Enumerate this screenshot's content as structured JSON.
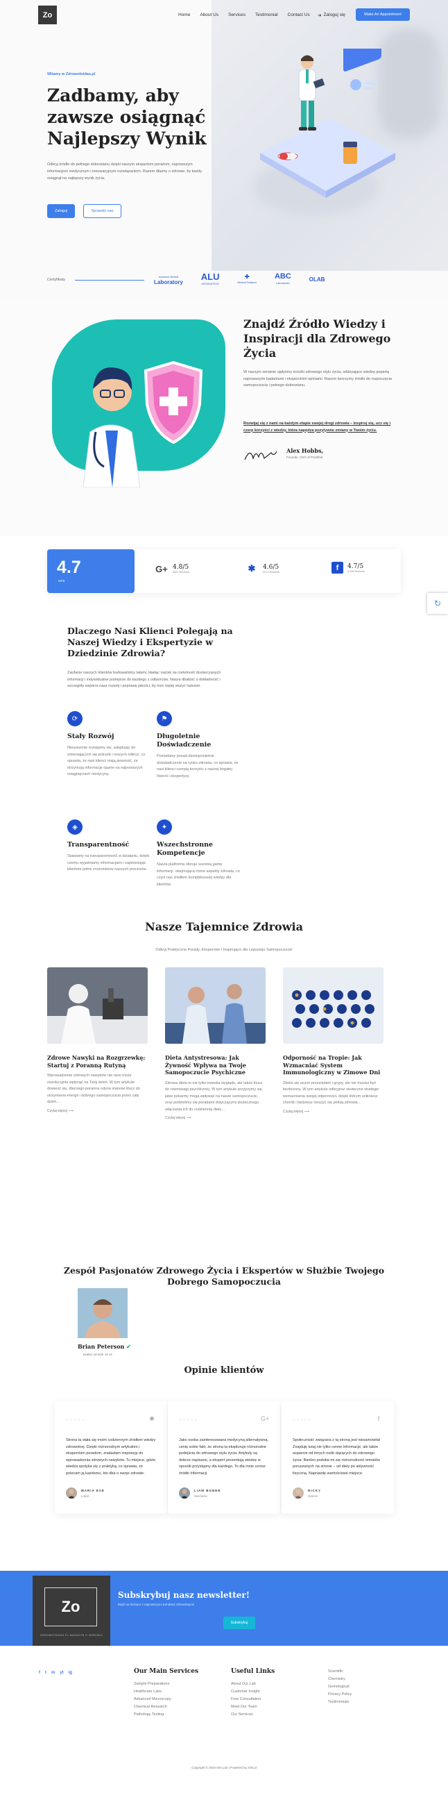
{
  "header": {
    "logo": "Zo",
    "nav": [
      "Home",
      "About Us",
      "Services",
      "Testimonial",
      "Contact Us"
    ],
    "login": "Zaloguj się",
    "cta": "Make An Appointment"
  },
  "hero": {
    "eyebrow": "Witamy w Zdrowotnidas.pl",
    "title": "Zadbamy, aby zawsze osiągnąć Najlepszy Wynik",
    "text": "Odkryj źródło do pełnego dobrostanu dzięki naszym ekspertom porażom, najnowszym informacjom medycznym i innowacyjnym rozwiązaniom. Razem dbamy o zdrowie, by każdy osiągnął na najlepszy wynik życia.",
    "btn_primary": "Zaloguj",
    "btn_outline": "Sprawdź nas"
  },
  "certified": {
    "label": "Certyfikaty",
    "logos": [
      {
        "name": "Laboratory",
        "small": "Advanced Medical"
      },
      {
        "name": "ALU",
        "small": "DESIGN&TECH"
      },
      {
        "name": "✚",
        "small": "Medical Solutions"
      },
      {
        "name": "ABC",
        "small": "Laboratories"
      },
      {
        "name": "OLAB",
        "small": ""
      }
    ]
  },
  "about": {
    "title": "Znajdź Źródło Wiedzy i Inspiracji dla Zdrowego Życia",
    "text": "W naszym serwisie ujęłyśmy ścieżki zdrowego stylu życia, oddzyające wiedzę popartą najnowszymi badaniami i eksperckimi opiniami. Razem tworzymy źródło do rozpoczęcia samopoczucia i pełnego dobrostanu.",
    "quote": "Rozwijaj się z nami na każdym etapie swojej drogi zdrowia – inspiruj się, ucz się i czerp korzyści z wiedzy, która napędza pozytywne zmiany w Twoim życiu.",
    "author": "Alex Hobbs,",
    "role": "Founder, CEO of Pointflub"
  },
  "ratings": {
    "main_value": "4.7",
    "main_label": "GPS",
    "items": [
      {
        "icon": "G+",
        "value": "4.8/5",
        "sub": "5467 Reviews"
      },
      {
        "icon": "✱",
        "value": "4.6/5",
        "sub": "3274 Reviews"
      },
      {
        "icon": "f",
        "value": "4.7/5",
        "sub": "3,435 Reviews"
      }
    ]
  },
  "why": {
    "title": "Dlaczego Nasi Klienci Polegają na Naszej Wiedzy i Ekspertyzie w Dziedzinie Zdrowia?",
    "text": "Zaufanie naszych klientów budowaliśmy latami, kładąc nacisk na rzetelność dostarczanych informacji i indywidualne podejście do każdego z odbiorców. Nasza dbałość o dokładność i szczegóły wspiera nasz rozwój i poprawę jakości, by móc lepiej służyć ludziom.",
    "features": [
      {
        "title": "Stały Rozwój",
        "text": "Nieustannie rozwijamy się, adaptując do zmieniających się potrzeb i nowych odkryć, co sprawia, że nasi klienci mają pewność, że otrzymują informacje oparte na najnowszych osiągnięciach medycyny."
      },
      {
        "title": "Długoletnie Doświadczenie",
        "text": "Posiadamy ponad dziesięcioletnie doświadczenie na rynku zdrowia, co sprawia, że nasi klienci czerpią korzyści z naszej bogatej historii i ekspertyzy."
      },
      {
        "title": "Transparentność",
        "text": "Stawiamy na transparentność w działaniu, dzięki czemu wyjaśniamy informacjami i zapewniając klientom pełne zrozumienie naszych procesów."
      },
      {
        "title": "Wszechstronne Kompetencje",
        "text": "Nasza platforma oferuje szeroką gamę informacji, obejmującą różne aspekty zdrowia, co czyni nas źródłem kompleksowej wiedzy dla klientów."
      }
    ]
  },
  "blog": {
    "title": "Nasze Tajemnice Zdrowia",
    "subtitle": "Odkryj Praktyczne Porady, Eksperckie i Inspirujące dla Lepszego Samopoczucia!",
    "posts": [
      {
        "title": "Zdrowe Nawyki na Rozgrzewkę: Startuj z Poranną Rutyną",
        "text": "Wprowadzenie zdrowych nawyków nie rano może rewolucyjnie wpłynąć na Twój dzień. W tym artykule dowiesz się, dlaczego poranna rutyna stanowi klucz do utrzymania energii i dobrego samopoczucia przez cały dzień…",
        "more": "Czytaj więcej"
      },
      {
        "title": "Dieta Antystresowa: Jak Żywność Wpływa na Twoje Samopoczucie Psychiczne",
        "text": "Zdrowa dieta to nie tylko kwestia wyglądu, ale także klucz do równowagi psychicznej. W tym artykule przyjrzymy się, jakie pokarmy mogą wpływać na nasze samopoczucie, oraz podzielimy się poradami dotyczącymi skutecznego włączania ich do codziennej diety…",
        "more": "Czytaj więcej"
      },
      {
        "title": "Odporność na Tropie: Jak Wzmacniać System Immunologiczny w Zimowe Dni",
        "text": "Zbliża się sezon przeziębień i grypy, ale nie musisz być bezbronny. W tym artykule odkryjesz skuteczne strategie wzmacniania swojej odporności, dzięki którym unikniesz chorób i będziesz cieszyć się pełnią zdrowia…",
        "more": "Czytaj więcej"
      }
    ]
  },
  "team": {
    "title": "Zespół Pasjonatów Zdrowego Życia i Ekspertów w Służbie Twojego Dobrego Samopoczucia",
    "name": "Brian Peterson",
    "role": "Doktor od Dzik 10 x4"
  },
  "testimonials": {
    "title": "Opinie klientów",
    "items": [
      {
        "text": "Strona ta stała się moim codziennym źródłem wiedzy zdrowotnej. Dzięki różnorodnym artykułom i eksperckim poradom, znalazłam inspirację do wprowadzenia zdrowych nawyków. Tu miejsce, gdzie wiedza spotyka się z praktyką, co sprawia, że polecam ją każdemu, kto dba o swoje zdrowie.",
        "name": "MARIA EVE",
        "role": "Lokal",
        "icon": "✱"
      },
      {
        "text": "Jako osoba zainteresowana medycyną alternatywną, cenię sobie fakt, że strona ta eksploruje różnorodne podejścia do zdrowego stylu życia. Artykuły są dobrze napisane, a ekspert prezentują wiedzę w sposób przystępny dla każdego. To dla mnie cenne źródło informacji.",
        "name": "LIAM BONER",
        "role": "Mechanic",
        "icon": "G+"
      },
      {
        "text": "Społeczność związana z tą stroną jest niesamowita! Znajduję tutaj nie tylko cenne informacje, ale także wsparcie od innych osób dążących do zdrowego życia. Bardzo podoba mi się różnorodność tematów poruszanych na stronie – od diety po aktywność fizyczną. Naprawdę wartościowe miejsce.",
        "name": "NICKY",
        "role": "Dancer",
        "icon": "f"
      }
    ]
  },
  "newsletter": {
    "logo_text": "Zo",
    "logo_caption": "ZDROWOTNIDAS.PL MAGAZYN O ZDROWIU",
    "title": "Subskrybuj nasz newsletter!",
    "subtitle": "Bądź na bieżąco z najnowszymi trendami zdrowotnymi!",
    "button": "Subskrybuj"
  },
  "footer": {
    "socials": [
      "f",
      "t",
      "in",
      "yt",
      "ig"
    ],
    "cols": [
      {
        "title": "Our Main Services",
        "links": [
          "Sample Preparations",
          "Healthcare Labs",
          "Advanced Microscopy",
          "Chemical Research",
          "Pathology Testing"
        ]
      },
      {
        "title": "Useful Links",
        "links": [
          "About Our Lab",
          "Customer Insight",
          "Free Consultation",
          "Meet Our Team",
          "Our Services"
        ]
      },
      {
        "title": "",
        "links": [
          "Scientific",
          "Chemistry",
          "Gemological",
          "Privacy Policy",
          "Testimonials"
        ]
      }
    ],
    "copyright": "Copyright © 2024 test.Lab | Powered by zeiti.pl"
  }
}
